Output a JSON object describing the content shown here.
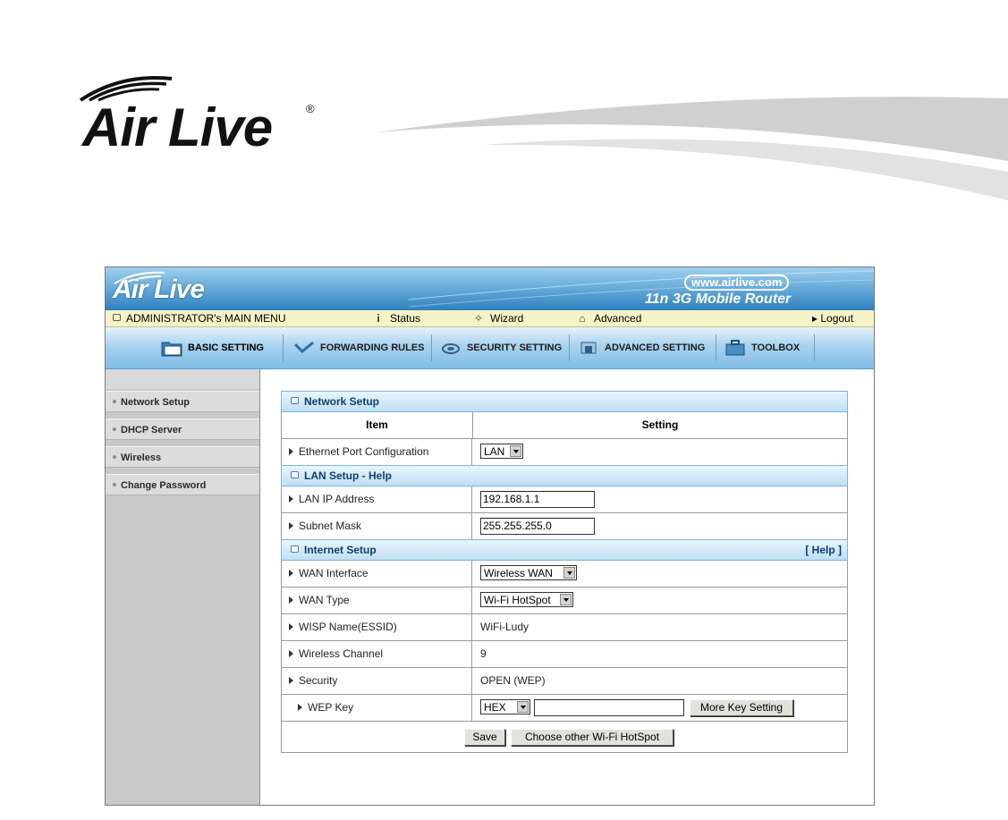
{
  "page_logo": {
    "brand": "Air Live",
    "reg": "®"
  },
  "banner": {
    "brand": "Air Live",
    "url": "www.airlive.com",
    "model": "11n 3G Mobile Router"
  },
  "menubar": {
    "main": "ADMINISTRATOR's MAIN MENU",
    "status": "Status",
    "wizard": "Wizard",
    "advanced": "Advanced",
    "logout": "▸ Logout"
  },
  "tabs": [
    {
      "label": "BASIC SETTING",
      "icon": "folder-icon"
    },
    {
      "label": "FORWARDING RULES",
      "icon": "arrows-icon"
    },
    {
      "label": "SECURITY SETTING",
      "icon": "lock-icon"
    },
    {
      "label": "ADVANCED SETTING",
      "icon": "gear-icon"
    },
    {
      "label": "TOOLBOX",
      "icon": "toolbox-icon"
    }
  ],
  "sidebar": [
    {
      "label": "Network Setup"
    },
    {
      "label": "DHCP Server"
    },
    {
      "label": "Wireless"
    },
    {
      "label": "Change Password"
    }
  ],
  "main": {
    "network_setup": "Network Setup",
    "col_item": "Item",
    "col_setting": "Setting",
    "eth_label": "Ethernet Port Configuration",
    "eth_value": "LAN",
    "lan_setup": "LAN Setup - Help",
    "lan_ip_label": "LAN IP Address",
    "lan_ip_value": "192.168.1.1",
    "subnet_label": "Subnet Mask",
    "subnet_value": "255.255.255.0",
    "internet_setup": "Internet Setup",
    "help": "[ Help ]",
    "wan_if_label": "WAN Interface",
    "wan_if_value": "Wireless WAN",
    "wan_type_label": "WAN Type",
    "wan_type_value": "Wi-Fi HotSpot",
    "wisp_label": "WISP Name(ESSID)",
    "wisp_value": "WiFi-Ludy",
    "channel_label": "Wireless Channel",
    "channel_value": "9",
    "security_label": "Security",
    "security_value": "OPEN (WEP)",
    "wep_label": "WEP Key",
    "wep_format": "HEX",
    "wep_key_value": "",
    "more_key_button": "More Key Setting",
    "save_button": "Save",
    "choose_button": "Choose other Wi-Fi HotSpot"
  }
}
